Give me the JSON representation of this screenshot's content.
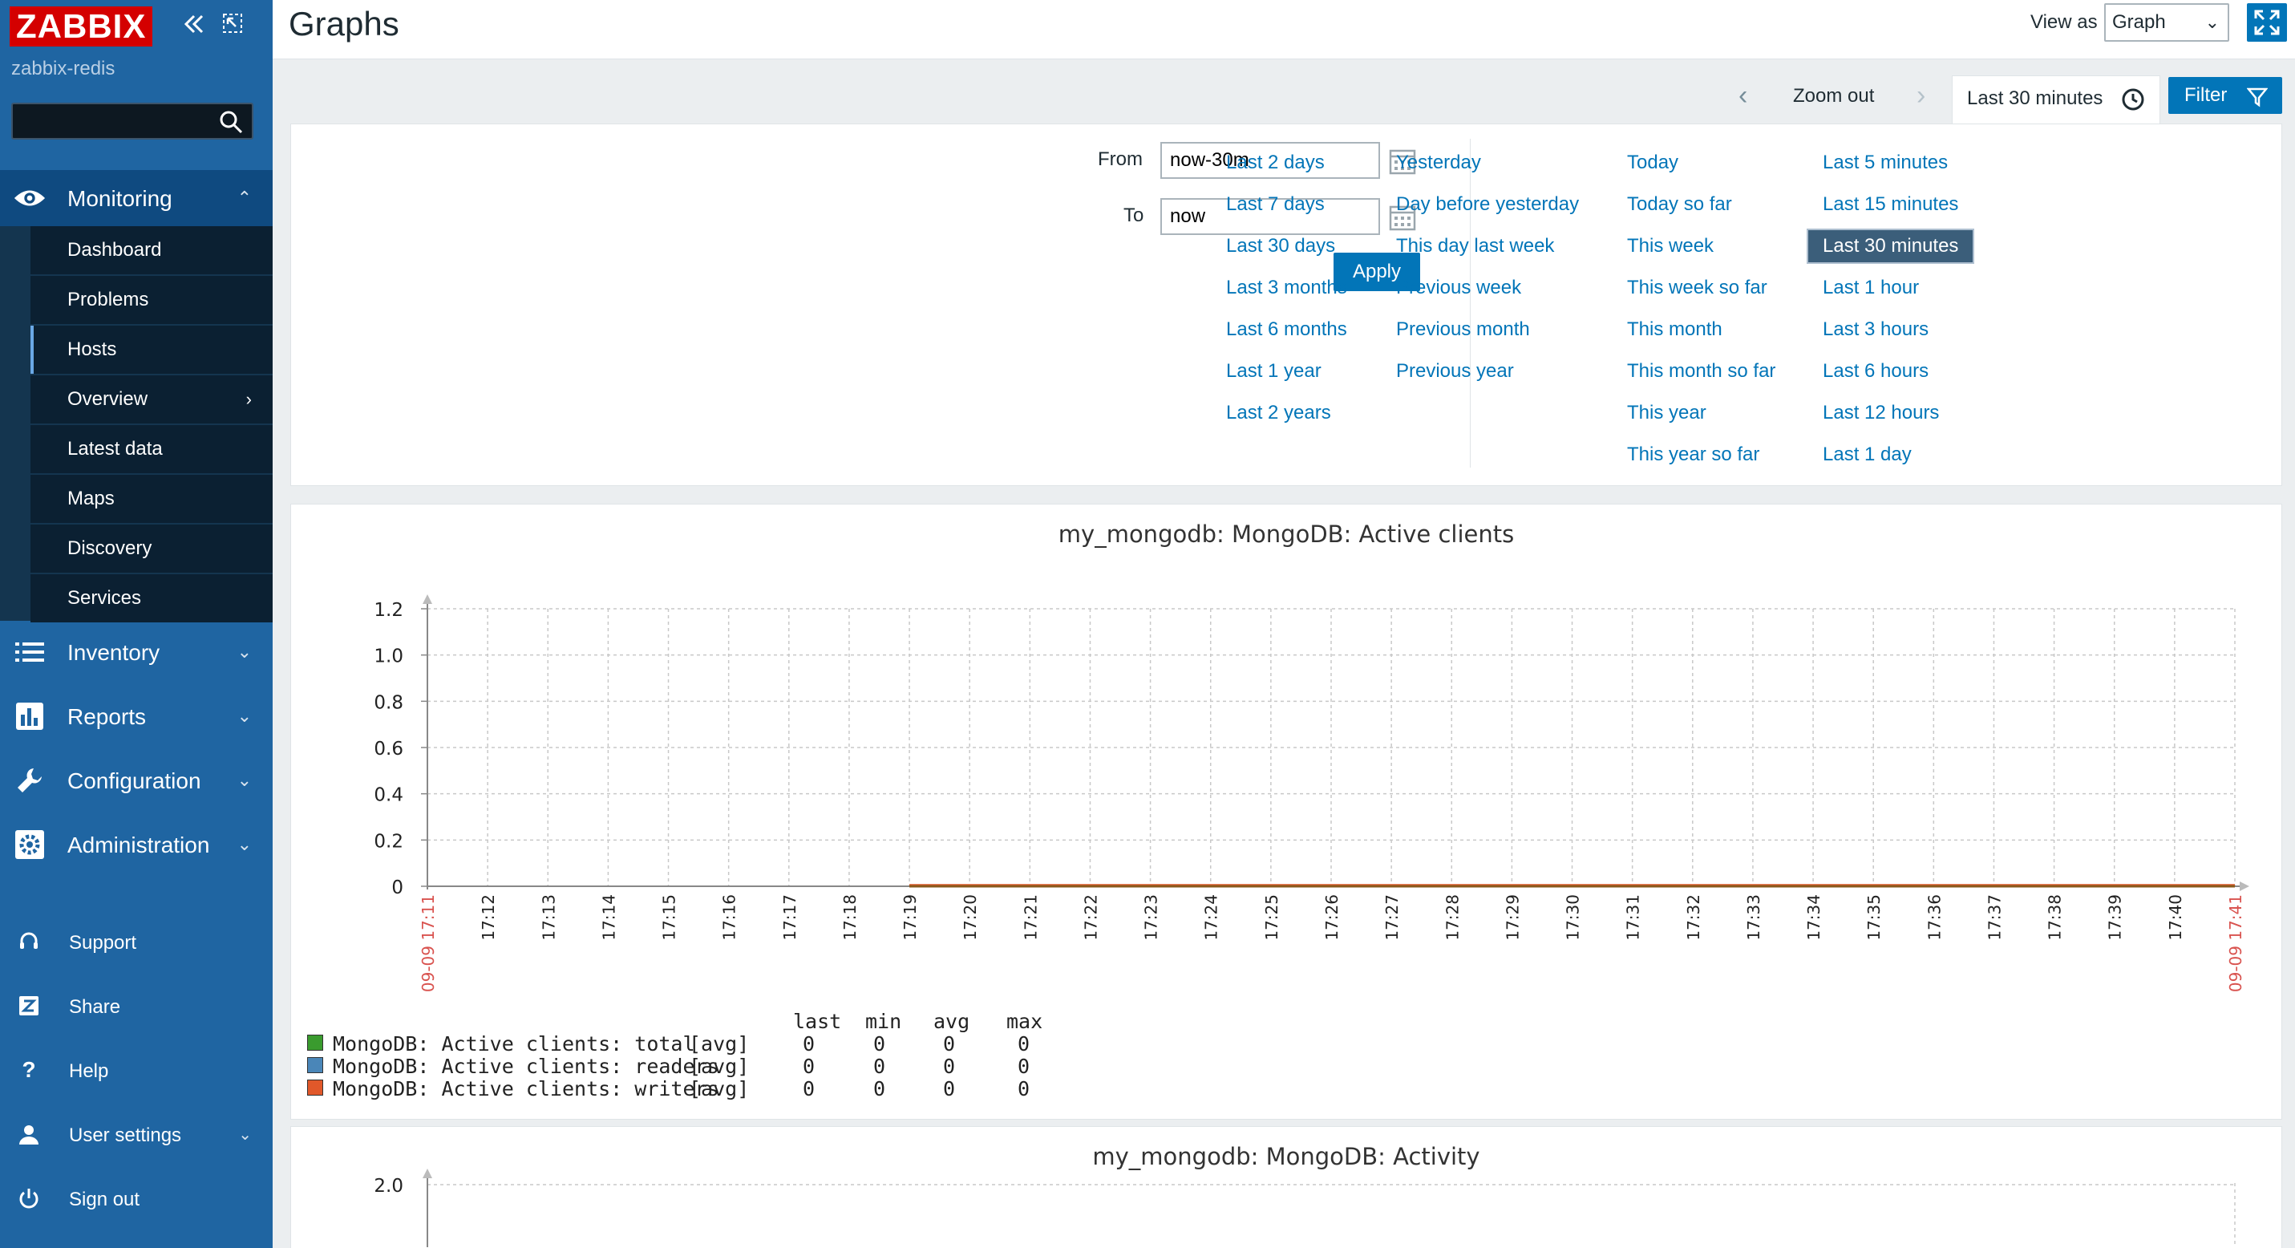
{
  "sidebar": {
    "logo": "ZABBIX",
    "host": "zabbix-redis",
    "search_placeholder": "",
    "main_menu": [
      {
        "label": "Monitoring",
        "icon": "eye-icon",
        "expanded": true
      },
      {
        "label": "Inventory",
        "icon": "list-icon"
      },
      {
        "label": "Reports",
        "icon": "bar-chart-icon"
      },
      {
        "label": "Configuration",
        "icon": "wrench-icon"
      },
      {
        "label": "Administration",
        "icon": "gear-icon"
      }
    ],
    "monitoring_items": [
      {
        "label": "Dashboard"
      },
      {
        "label": "Problems"
      },
      {
        "label": "Hosts",
        "selected": true
      },
      {
        "label": "Overview",
        "has_submenu": true
      },
      {
        "label": "Latest data"
      },
      {
        "label": "Maps"
      },
      {
        "label": "Discovery"
      },
      {
        "label": "Services"
      }
    ],
    "bottom_menu": [
      {
        "label": "Support",
        "icon": "headset-icon"
      },
      {
        "label": "Share",
        "icon": "zabbix-share-icon"
      },
      {
        "label": "Help",
        "icon": "question-icon"
      },
      {
        "label": "User settings",
        "icon": "user-icon"
      },
      {
        "label": "Sign out",
        "icon": "power-icon"
      }
    ]
  },
  "header": {
    "title": "Graphs",
    "view_as_label": "View as",
    "view_as_value": "Graph"
  },
  "filter_bar": {
    "zoom_out": "Zoom out",
    "time_tab": "Last 30 minutes",
    "filter_button": "Filter"
  },
  "time_filter": {
    "from_label": "From",
    "from_value": "now-30m",
    "to_label": "To",
    "to_value": "now",
    "apply": "Apply",
    "quick_ranges": [
      [
        "Last 2 days",
        "Last 7 days",
        "Last 30 days",
        "Last 3 months",
        "Last 6 months",
        "Last 1 year",
        "Last 2 years"
      ],
      [
        "Yesterday",
        "Day before yesterday",
        "This day last week",
        "Previous week",
        "Previous month",
        "Previous year"
      ],
      [
        "Today",
        "Today so far",
        "This week",
        "This week so far",
        "This month",
        "This month so far",
        "This year",
        "This year so far"
      ],
      [
        "Last 5 minutes",
        "Last 15 minutes",
        "Last 30 minutes",
        "Last 1 hour",
        "Last 3 hours",
        "Last 6 hours",
        "Last 12 hours",
        "Last 1 day"
      ]
    ],
    "selected_range": "Last 30 minutes"
  },
  "graphs": [
    {
      "title": "my_mongodb: MongoDB: Active clients",
      "legend_headers": [
        "last",
        "min",
        "avg",
        "max"
      ],
      "legend": [
        {
          "name": "MongoDB: Active clients: total",
          "func": "[avg]",
          "last": "0",
          "min": "0",
          "avg": "0",
          "max": "0",
          "color": "#3a9b2e"
        },
        {
          "name": "MongoDB: Active clients: readers",
          "func": "[avg]",
          "last": "0",
          "min": "0",
          "avg": "0",
          "max": "0",
          "color": "#4a86b8"
        },
        {
          "name": "MongoDB: Active clients: writers",
          "func": "[avg]",
          "last": "0",
          "min": "0",
          "avg": "0",
          "max": "0",
          "color": "#e1582a"
        }
      ]
    },
    {
      "title": "my_mongodb: MongoDB: Activity"
    }
  ],
  "chart_data": [
    {
      "type": "line",
      "title": "my_mongodb: MongoDB: Active clients",
      "ylim": [
        0,
        1.2
      ],
      "y_ticks": [
        "1.2",
        "1.0",
        "0.8",
        "0.6",
        "0.4",
        "0.2",
        "0"
      ],
      "x_start_label": "09-09 17:11",
      "x_end_label": "09-09 17:41",
      "x_ticks": [
        "17:12",
        "17:13",
        "17:14",
        "17:15",
        "17:16",
        "17:17",
        "17:18",
        "17:19",
        "17:20",
        "17:21",
        "17:22",
        "17:23",
        "17:24",
        "17:25",
        "17:26",
        "17:27",
        "17:28",
        "17:29",
        "17:30",
        "17:31",
        "17:32",
        "17:33",
        "17:34",
        "17:35",
        "17:36",
        "17:37",
        "17:38",
        "17:39",
        "17:40"
      ],
      "series": [
        {
          "name": "MongoDB: Active clients: total",
          "color": "#3a9b2e",
          "x": [
            "17:19",
            "17:41"
          ],
          "values": [
            0,
            0
          ]
        },
        {
          "name": "MongoDB: Active clients: readers",
          "color": "#4a86b8",
          "x": [
            "17:19",
            "17:41"
          ],
          "values": [
            0,
            0
          ]
        },
        {
          "name": "MongoDB: Active clients: writers",
          "color": "#e1582a",
          "x": [
            "17:19",
            "17:41"
          ],
          "values": [
            0,
            0
          ]
        }
      ],
      "grid": true
    },
    {
      "type": "line",
      "title": "my_mongodb: MongoDB: Activity",
      "y_ticks": [
        "2.0"
      ],
      "grid": true
    }
  ]
}
